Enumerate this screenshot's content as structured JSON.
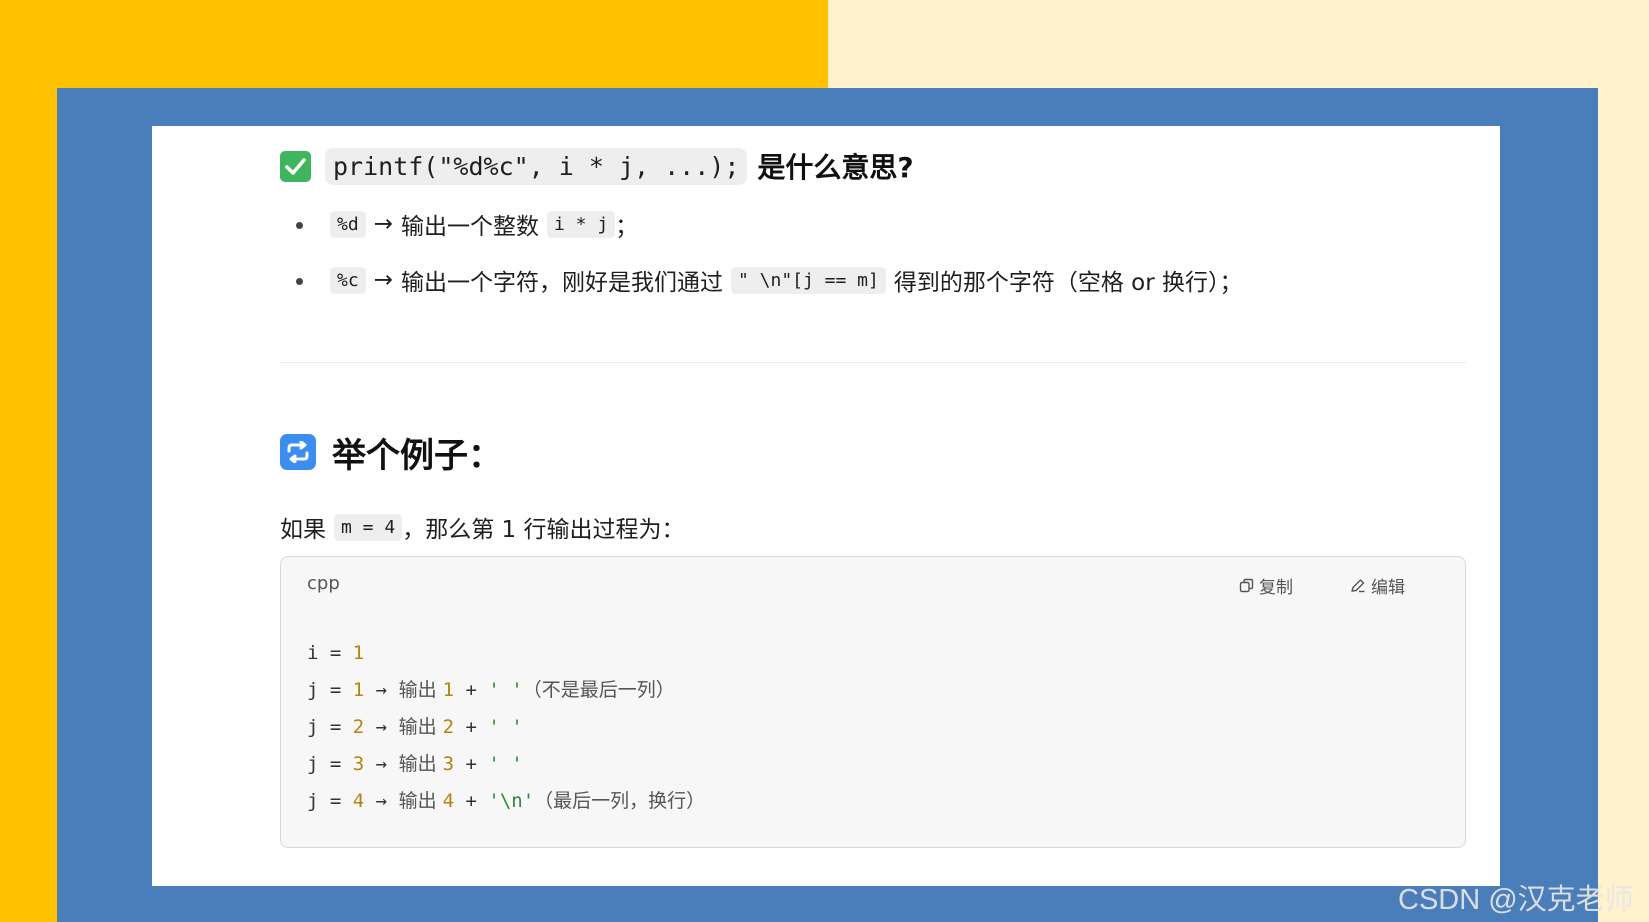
{
  "section1": {
    "code": "printf(\"%d%c\", i * j, ...);",
    "title": "是什么意思?"
  },
  "bullets": [
    {
      "code": "%d",
      "arrow": "→",
      "text": "输出一个整数",
      "code2": "i * j",
      "tail": "；"
    },
    {
      "code": "%c",
      "arrow": "→",
      "text": "输出一个字符，刚好是我们通过",
      "code2": "\" \\n\"[j == m]",
      "tail": "得到的那个字符（空格 or 换行）；"
    }
  ],
  "section2": {
    "title": "举个例子："
  },
  "para": {
    "pre": "如果",
    "code": "m = 4",
    "post": "，那么第 1 行输出过程为："
  },
  "codeblock": {
    "lang": "cpp",
    "copy_label": "复制",
    "edit_label": "编辑",
    "lines": [
      {
        "a": "i",
        "eq": " = ",
        "n": "1"
      },
      {
        "a": "j",
        "eq": " = ",
        "n": "1",
        "arrow": " → ",
        "out": "输出 ",
        "n2": "1",
        "plus": " + ",
        "s": "' '",
        "c": "（不是最后一列）"
      },
      {
        "a": "j",
        "eq": " = ",
        "n": "2",
        "arrow": " → ",
        "out": "输出 ",
        "n2": "2",
        "plus": " + ",
        "s": "' '"
      },
      {
        "a": "j",
        "eq": " = ",
        "n": "3",
        "arrow": " → ",
        "out": "输出 ",
        "n2": "3",
        "plus": " + ",
        "s": "' '"
      },
      {
        "a": "j",
        "eq": " = ",
        "n": "4",
        "arrow": " → ",
        "out": "输出 ",
        "n2": "4",
        "plus": " + ",
        "s": "'\\n'",
        "c": "（最后一列，换行）"
      }
    ]
  },
  "watermark": "CSDN @汉克老师",
  "colors": {
    "yellow": "#ffc000",
    "cream": "#fff2cc",
    "blue": "#4a7ebb",
    "check_green": "#3fb560",
    "icon_blue": "#3b8ef0"
  }
}
